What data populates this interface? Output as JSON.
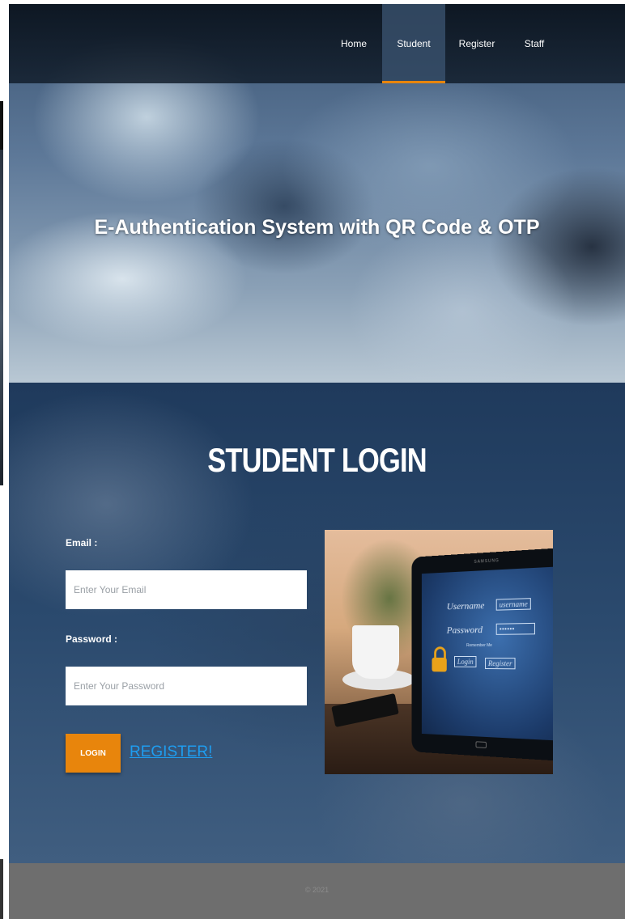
{
  "nav": {
    "items": [
      {
        "label": "Home",
        "active": false
      },
      {
        "label": "Student",
        "active": true
      },
      {
        "label": "Register",
        "active": false
      },
      {
        "label": "Staff",
        "active": false
      }
    ]
  },
  "hero": {
    "title": "E-Authentication System with QR Code & OTP"
  },
  "login": {
    "title": "STUDENT LOGIN",
    "email_label": "Email :",
    "email_placeholder": "Enter Your Email",
    "email_value": "",
    "password_label": "Password :",
    "password_placeholder": "Enter Your Password",
    "password_value": "",
    "login_button": "LOGIN",
    "register_link": "REGISTER!"
  },
  "illustration": {
    "brand": "SAMSUNG",
    "username_label": "Username",
    "username_box": "username",
    "password_label": "Password",
    "password_box": "••••••",
    "remember_text": "Remember Me",
    "login_box": "Login",
    "register_box": "Register"
  },
  "footer": {
    "copyright": "© 2021"
  },
  "colors": {
    "accent": "#e8850c",
    "link": "#1e9df0",
    "footer_bg": "#6e6e6e"
  }
}
